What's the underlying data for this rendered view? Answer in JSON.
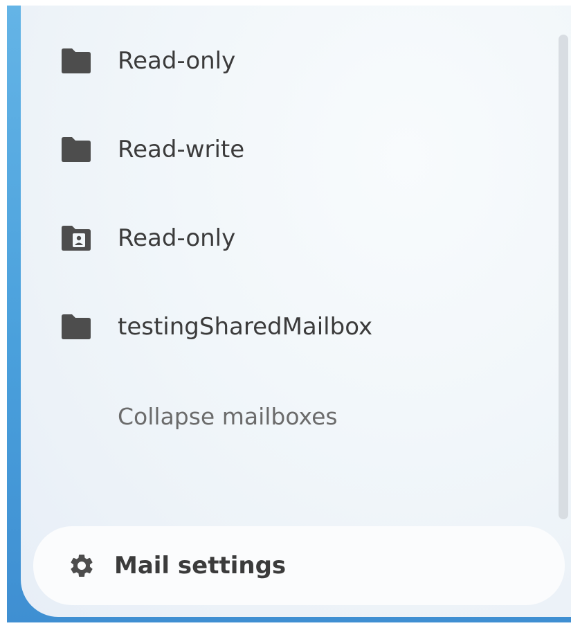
{
  "folders": [
    {
      "label": "Read-only",
      "icon": "folder-icon"
    },
    {
      "label": "Read-write",
      "icon": "folder-icon"
    },
    {
      "label": "Read-only",
      "icon": "shared-folder-icon"
    },
    {
      "label": "testingSharedMailbox",
      "icon": "folder-icon"
    }
  ],
  "collapse_label": "Collapse mailboxes",
  "settings": {
    "label": "Mail settings",
    "icon": "gear-icon"
  },
  "colors": {
    "icon": "#4d4d4d",
    "text": "#3b3b3b",
    "muted_text": "#6b6b6b",
    "accent_blue": "#4aa0dc"
  }
}
